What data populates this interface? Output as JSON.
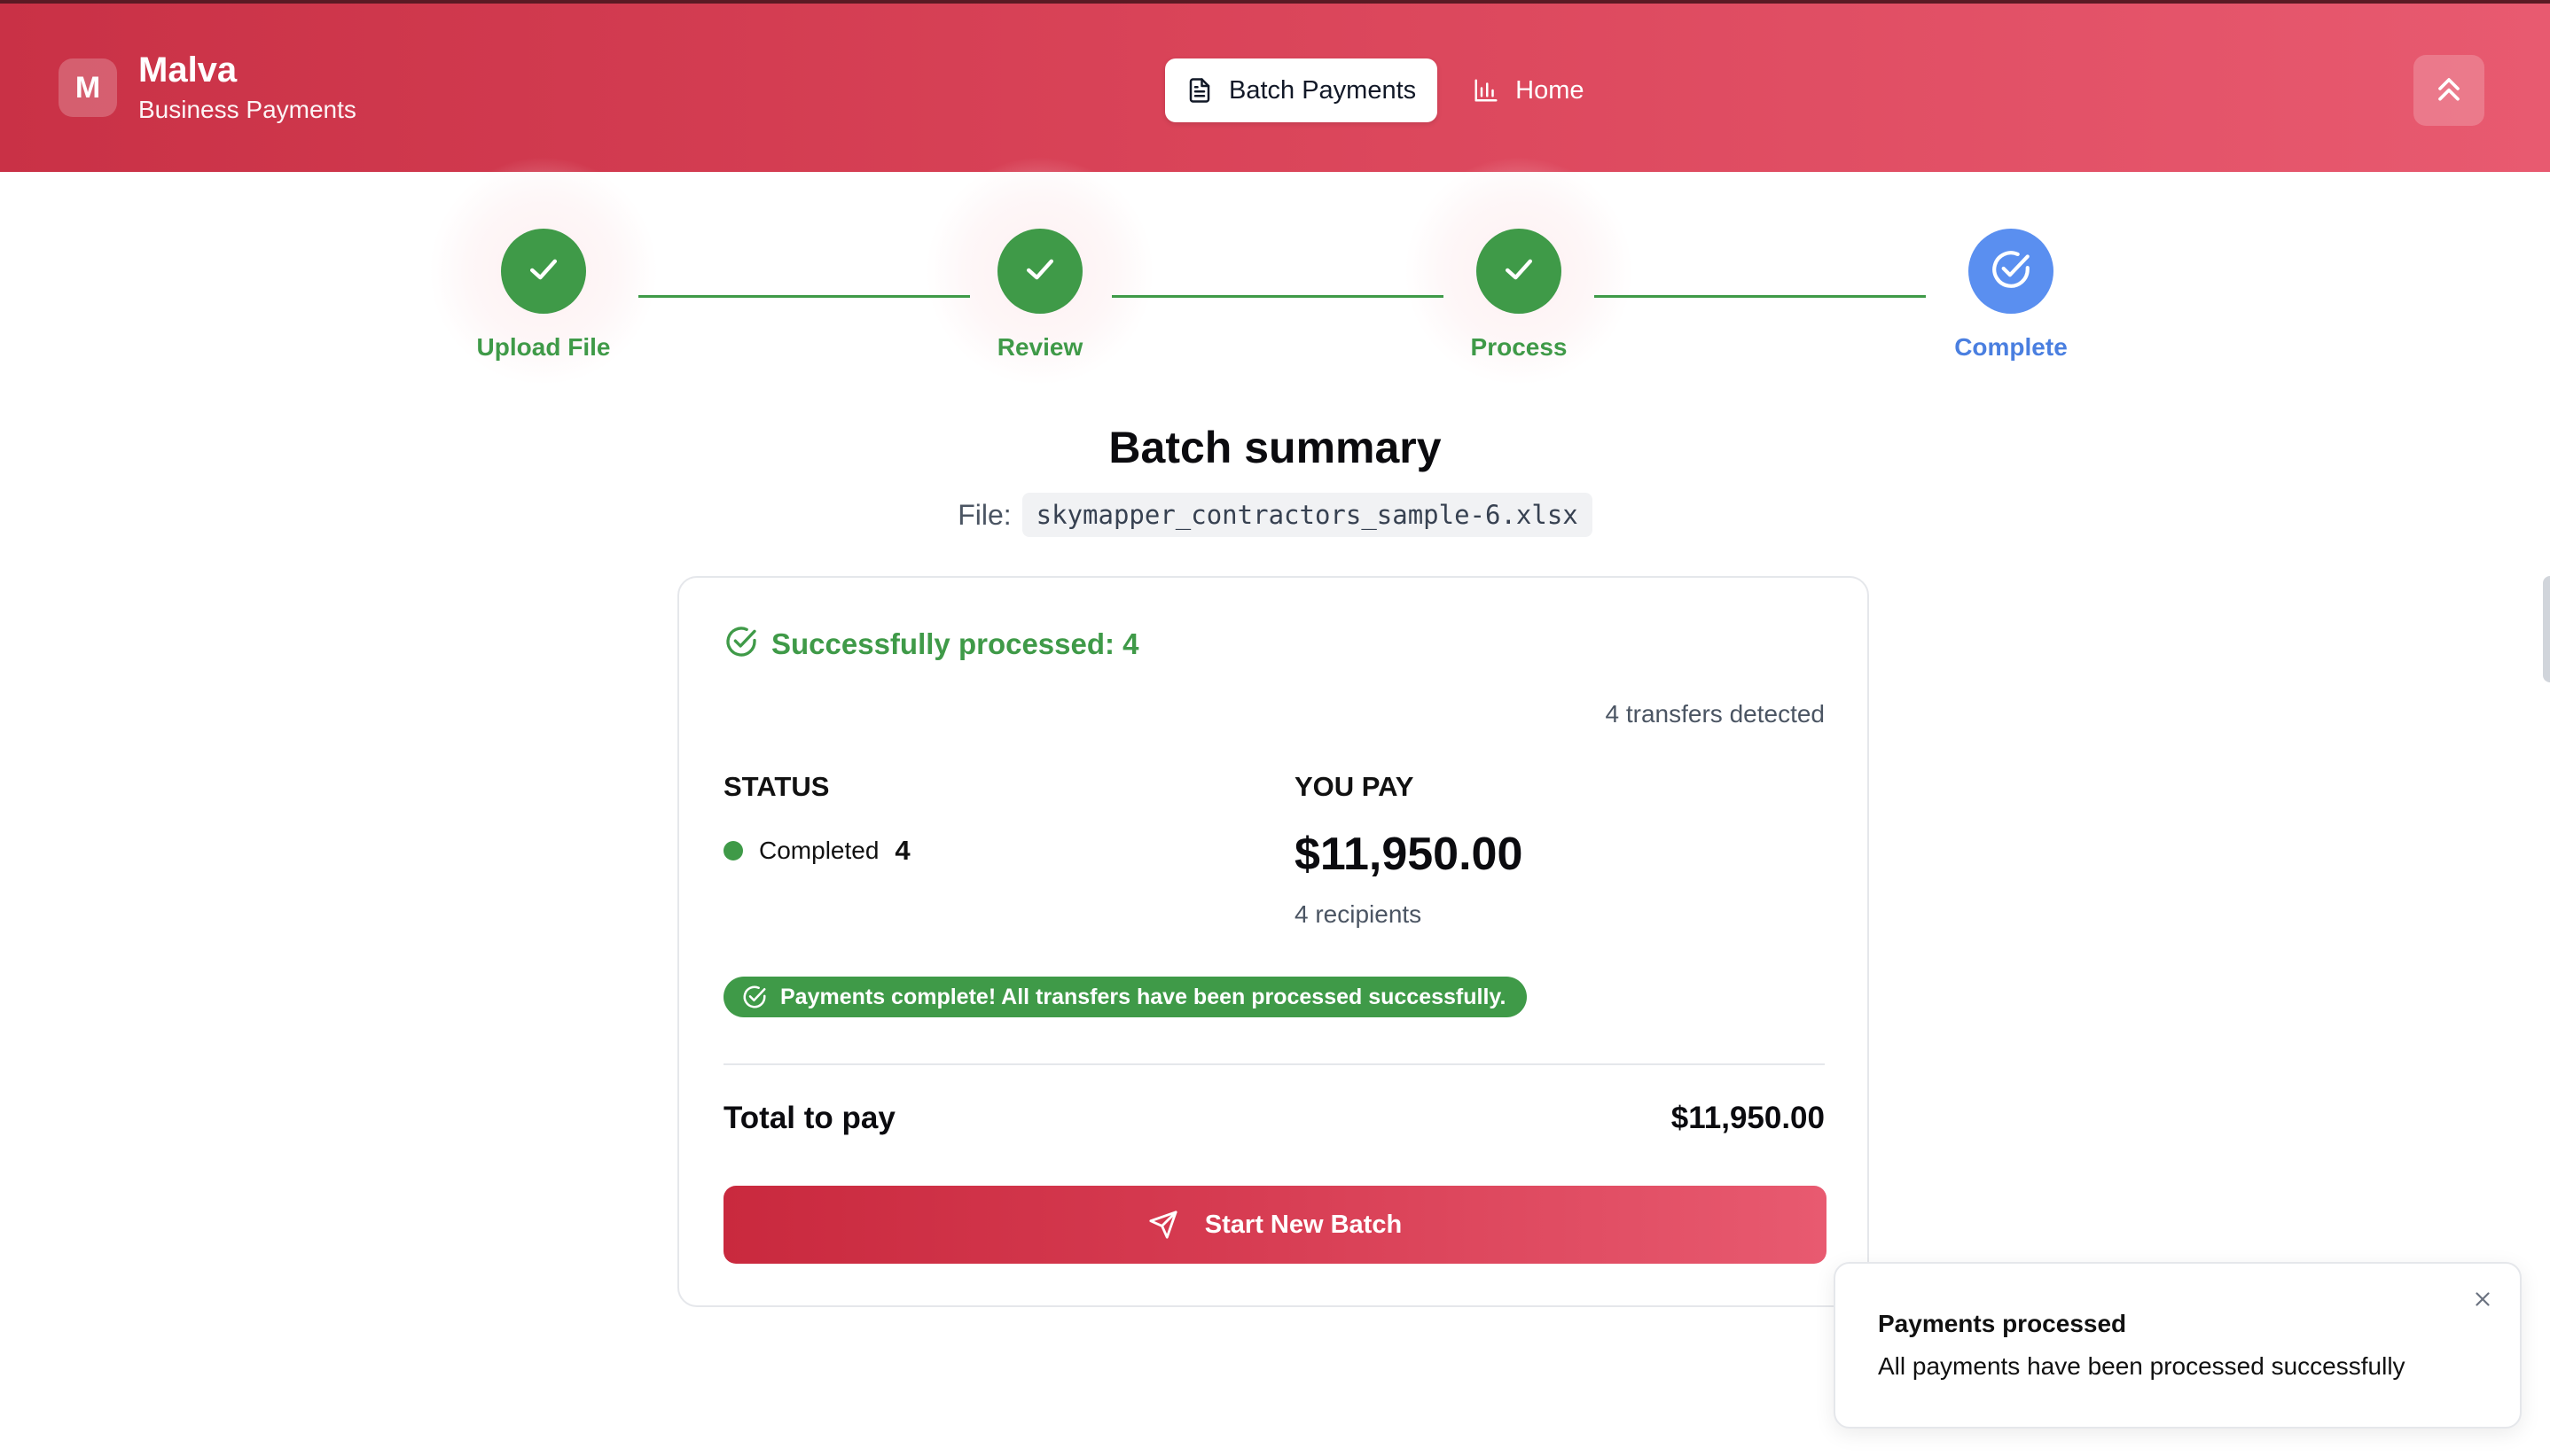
{
  "app": {
    "logo_letter": "M",
    "name": "Malva",
    "subtitle": "Business Payments"
  },
  "nav": {
    "items": [
      {
        "label": "Batch Payments",
        "icon": "document-icon",
        "active": true
      },
      {
        "label": "Home",
        "icon": "bar-chart-icon",
        "active": false
      }
    ]
  },
  "stepper": {
    "steps": [
      {
        "label": "Upload File",
        "state": "done"
      },
      {
        "label": "Review",
        "state": "done"
      },
      {
        "label": "Process",
        "state": "done"
      },
      {
        "label": "Complete",
        "state": "current"
      }
    ]
  },
  "summary": {
    "title": "Batch summary",
    "file_label": "File:",
    "file_name": "skymapper_contractors_sample-6.xlsx"
  },
  "card": {
    "success_text": "Successfully processed: 4",
    "detected": "4 transfers detected",
    "status_heading": "STATUS",
    "status_label": "Completed",
    "status_count": "4",
    "pay_heading": "YOU PAY",
    "pay_amount": "$11,950.00",
    "pay_recipients": "4 recipients",
    "complete_message": "Payments complete! All transfers have been processed successfully.",
    "total_label": "Total to pay",
    "total_amount": "$11,950.00",
    "start_button": "Start New Batch"
  },
  "toast": {
    "title": "Payments processed",
    "message": "All payments have been processed successfully"
  },
  "colors": {
    "brand": "#d94358",
    "success": "#3f9a48",
    "current_step": "#5a8ff0"
  }
}
